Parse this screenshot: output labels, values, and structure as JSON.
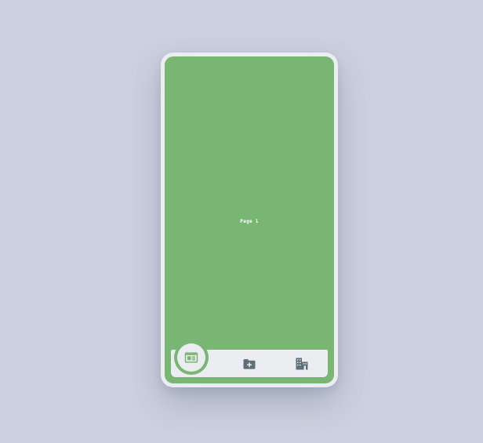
{
  "screen": {
    "label": "Page 1",
    "background": "#79b573"
  },
  "tabbar": {
    "active_index": 0,
    "active_color": "#79b573",
    "icon_color": "#5f6f78",
    "items": [
      {
        "icon": "newspaper-icon",
        "active": true
      },
      {
        "icon": "folder-add-icon",
        "active": false
      },
      {
        "icon": "buildings-icon",
        "active": false
      }
    ]
  }
}
